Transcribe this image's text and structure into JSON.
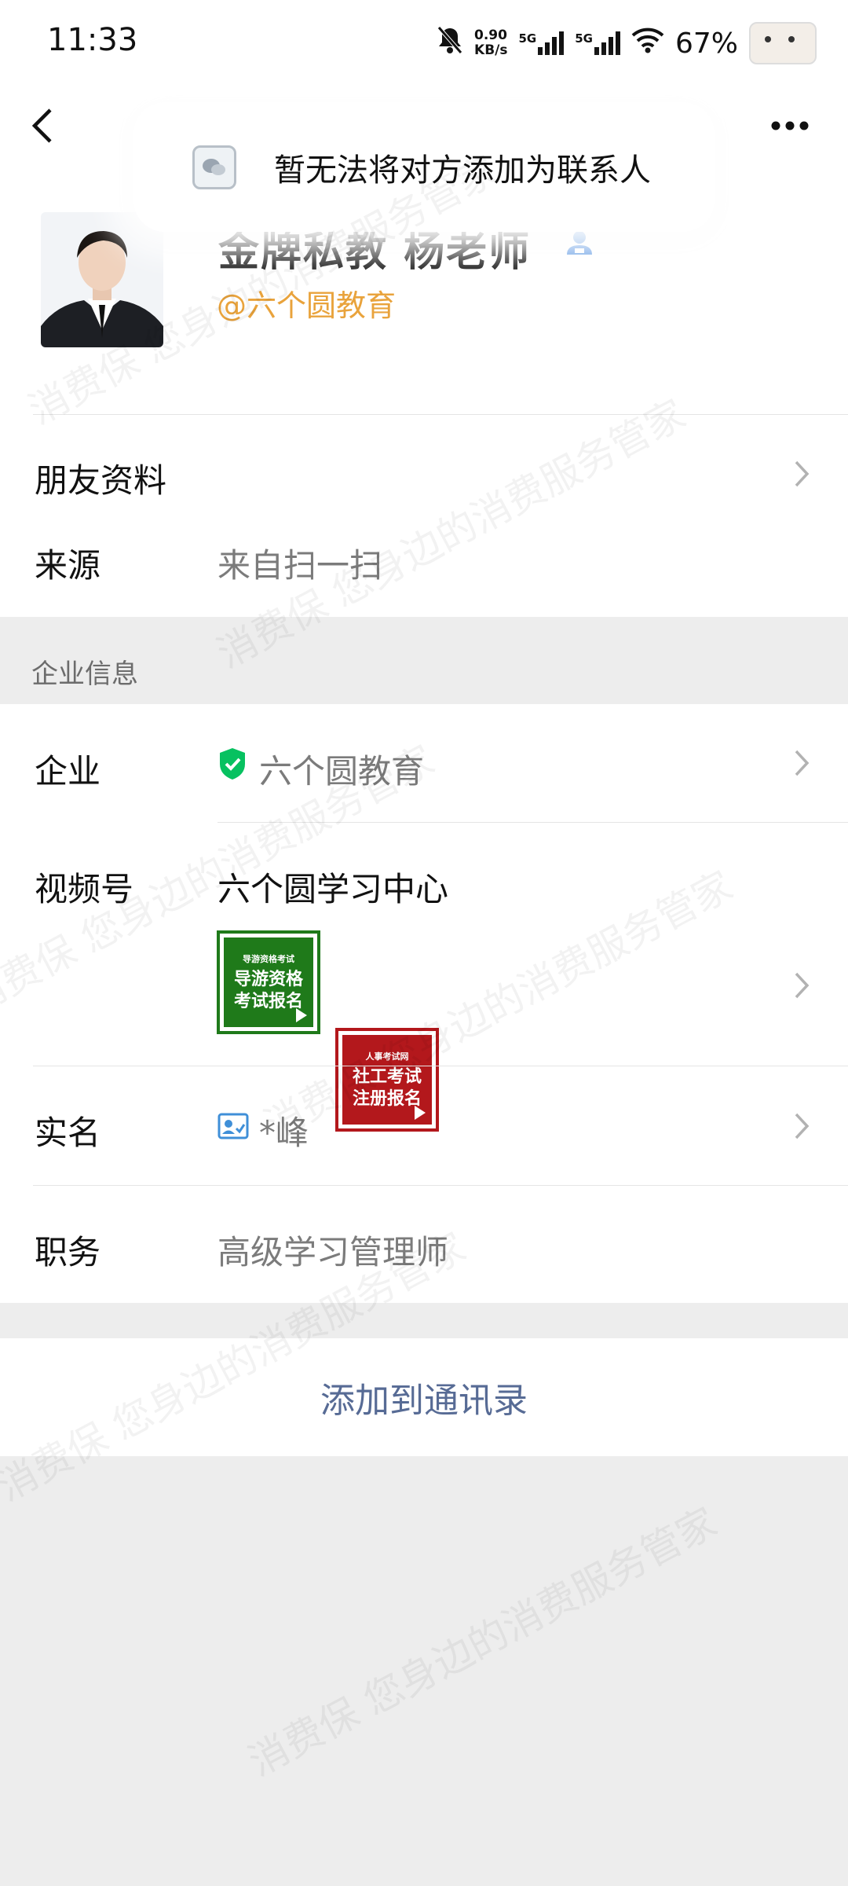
{
  "status_bar": {
    "time": "11:33",
    "net_speed_value": "0.90",
    "net_speed_unit": "KB/s",
    "sim1_label": "5G",
    "sim2_label": "5G",
    "battery": "67%"
  },
  "toast": {
    "text": "暂无法将对方添加为联系人"
  },
  "profile": {
    "name": "金牌私教 杨老师",
    "org_tag": "@六个圆教育"
  },
  "friend_info": {
    "label": "朋友资料"
  },
  "source": {
    "label": "来源",
    "value": "来自扫一扫"
  },
  "enterprise_section": {
    "title": "企业信息"
  },
  "company": {
    "label": "企业",
    "value": "六个圆教育"
  },
  "channels": {
    "label": "视频号",
    "value": "六个圆学习中心",
    "thumbs": [
      {
        "small": "导游资格考试",
        "line1": "导游资格",
        "line2": "考试报名",
        "color": "#1f7a1a"
      },
      {
        "small": "人事考试网",
        "line1": "社工考试",
        "line2": "注册报名",
        "color": "#b3181c"
      }
    ]
  },
  "real_name": {
    "label": "实名",
    "value": "*峰"
  },
  "position": {
    "label": "职务",
    "value": "高级学习管理师"
  },
  "add_button": {
    "label": "添加到通讯录"
  },
  "watermarks": {
    "a": "消费保 您身边的消费服务管家"
  },
  "colors": {
    "link_blue": "#576b95",
    "org_orange": "#e9a33c",
    "verified_green": "#07c160"
  }
}
